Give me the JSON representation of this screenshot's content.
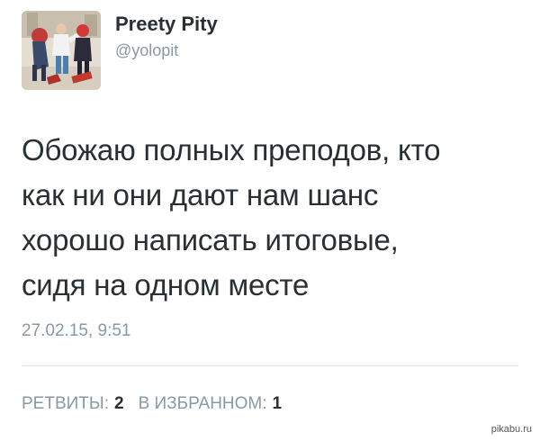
{
  "user": {
    "display_name": "Preety Pity",
    "handle": "@yolopit"
  },
  "tweet": {
    "lines": [
      "Обожаю полных преподов, кто",
      "как ни они дают нам шанс",
      "хорошо написать итоговые,",
      "сидя на одном месте"
    ],
    "timestamp": "27.02.15, 9:51"
  },
  "stats": {
    "retweets_label": "РЕТВИТЫ:",
    "retweets_count": "2",
    "favorites_label": "В ИЗБРАННОМ:",
    "favorites_count": "1"
  },
  "watermark": "pikabu.ru",
  "colors": {
    "text": "#292f33",
    "muted": "#8899a6",
    "divider": "#e1e8ed"
  }
}
